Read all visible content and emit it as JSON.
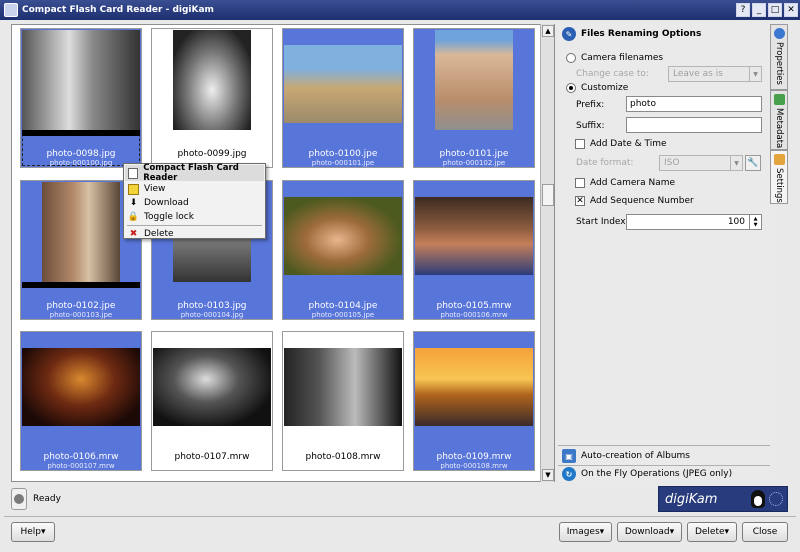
{
  "window": {
    "title": "Compact Flash Card Reader - digiKam",
    "controls": [
      "?",
      "_",
      "□",
      "✕"
    ]
  },
  "thumbnails": [
    {
      "name": "photo-0098.jpg",
      "sub": "photo-000100.jpg",
      "selected": true,
      "focused": true
    },
    {
      "name": "photo-0099.jpg",
      "sub": "",
      "selected": false
    },
    {
      "name": "photo-0100.jpe",
      "sub": "photo-000101.jpe",
      "selected": true
    },
    {
      "name": "photo-0101.jpe",
      "sub": "photo-000102.jpe",
      "selected": true
    },
    {
      "name": "photo-0102.jpe",
      "sub": "photo-000103.jpe",
      "selected": true
    },
    {
      "name": "photo-0103.jpg",
      "sub": "photo-000104.jpg",
      "selected": true
    },
    {
      "name": "photo-0104.jpe",
      "sub": "photo-000105.jpe",
      "selected": true
    },
    {
      "name": "photo-0105.mrw",
      "sub": "photo-000106.mrw",
      "selected": true
    },
    {
      "name": "photo-0106.mrw",
      "sub": "photo-000107.mrw",
      "selected": true
    },
    {
      "name": "photo-0107.mrw",
      "sub": "",
      "selected": false
    },
    {
      "name": "photo-0108.mrw",
      "sub": "",
      "selected": false
    },
    {
      "name": "photo-0109.mrw",
      "sub": "photo-000108.mrw",
      "selected": true
    }
  ],
  "context_menu": {
    "header": "Compact Flash Card Reader",
    "items": [
      "View",
      "Download",
      "Toggle lock",
      "Delete"
    ]
  },
  "renaming": {
    "title": "Files Renaming Options",
    "camera_filenames": "Camera filenames",
    "change_case_label": "Change case to:",
    "change_case_value": "Leave as is",
    "customize": "Customize",
    "prefix_label": "Prefix:",
    "prefix_value": "photo",
    "suffix_label": "Suffix:",
    "suffix_value": "",
    "add_date_time": "Add Date & Time",
    "date_format_label": "Date format:",
    "date_format_value": "ISO",
    "add_camera_name": "Add Camera Name",
    "add_sequence_number": "Add Sequence Number",
    "start_index_label": "Start Index:",
    "start_index_value": "100"
  },
  "sidebar_tabs": [
    "Properties",
    "Metadata",
    "Settings"
  ],
  "sections": {
    "auto_albums": "Auto-creation of Albums",
    "on_the_fly": "On the Fly Operations (JPEG only)"
  },
  "status": {
    "text": "Ready"
  },
  "logo": {
    "text": "digiKam"
  },
  "buttons": {
    "help": "Help",
    "images": "Images",
    "download": "Download",
    "delete": "Delete",
    "close": "Close"
  },
  "colors": {
    "selection": "#5875d9",
    "titlebar": "#1c2f70"
  }
}
